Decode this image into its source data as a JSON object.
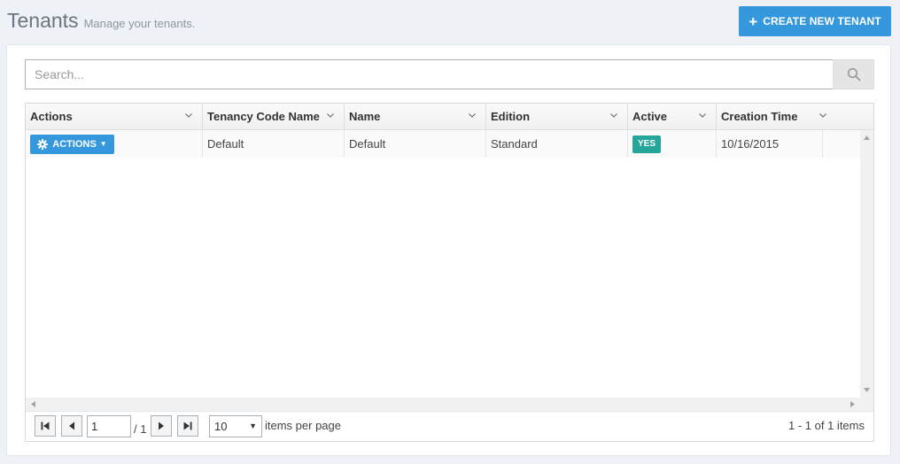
{
  "header": {
    "title": "Tenants",
    "subtitle": "Manage your tenants.",
    "create_button": "CREATE NEW TENANT"
  },
  "search": {
    "placeholder": "Search...",
    "value": ""
  },
  "grid": {
    "columns": [
      "Actions",
      "Tenancy Code Name",
      "Name",
      "Edition",
      "Active",
      "Creation Time"
    ],
    "rows": [
      {
        "actions_label": "ACTIONS",
        "tenancy_code_name": "Default",
        "name": "Default",
        "edition": "Standard",
        "active": "YES",
        "creation_time": "10/16/2015"
      }
    ]
  },
  "pager": {
    "current_page": "1",
    "total_pages": "/ 1",
    "page_size": "10",
    "items_per_page_label": "items per page",
    "info": "1 - 1 of 1 items"
  },
  "colors": {
    "primary": "#3598dc",
    "active_badge": "#26a69a",
    "title": "#6b7480"
  }
}
